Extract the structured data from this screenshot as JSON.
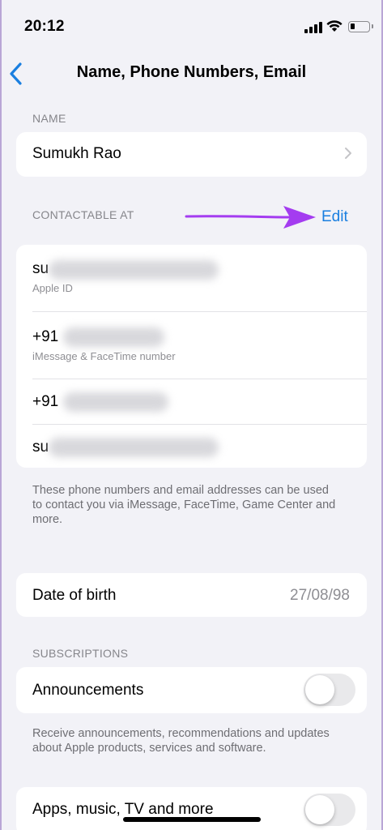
{
  "status_bar": {
    "time": "20:12",
    "signal": "signal-icon",
    "wifi": "wifi-icon",
    "battery": "battery-icon"
  },
  "nav": {
    "title": "Name, Phone Numbers, Email",
    "back_icon": "chevron-left-icon"
  },
  "name_section": {
    "header": "NAME",
    "value": "Sumukh Rao"
  },
  "contact_section": {
    "header": "CONTACTABLE AT",
    "edit_label": "Edit",
    "edit_color": "#1a7fe0",
    "arrow_color": "#a43cf0",
    "items": [
      {
        "prefix": "su",
        "subtitle": "Apple ID"
      },
      {
        "prefix": "+91",
        "subtitle": "iMessage & FaceTime number"
      },
      {
        "prefix": "+91",
        "subtitle": ""
      },
      {
        "prefix": "su",
        "subtitle": ""
      }
    ],
    "footer": "These phone numbers and email addresses can be used to contact you via iMessage, FaceTime, Game Center and more."
  },
  "dob": {
    "label": "Date of birth",
    "value": "27/08/98"
  },
  "subscriptions": {
    "header": "SUBSCRIPTIONS",
    "announcements_label": "Announcements",
    "announcements_on": false,
    "announcements_footer": "Receive announcements, recommendations and updates about Apple products, services and software.",
    "apps_label": "Apps, music, TV and more",
    "apps_on": false
  }
}
